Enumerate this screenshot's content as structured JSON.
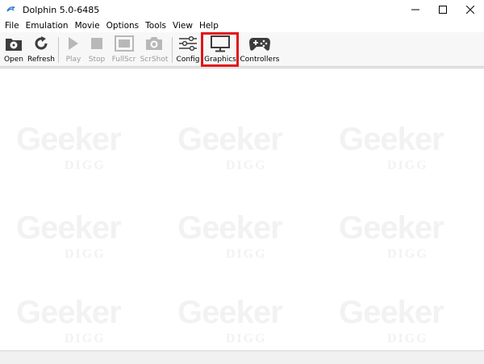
{
  "window": {
    "title": "Dolphin 5.0-6485",
    "icon": "dolphin-icon",
    "controls": [
      "minimize-icon",
      "maximize-icon",
      "close-icon"
    ]
  },
  "menu": [
    "File",
    "Emulation",
    "Movie",
    "Options",
    "Tools",
    "View",
    "Help"
  ],
  "toolbar": {
    "open": {
      "label": "Open",
      "icon": "folder-open-icon",
      "enabled": true
    },
    "refresh": {
      "label": "Refresh",
      "icon": "refresh-icon",
      "enabled": true
    },
    "play": {
      "label": "Play",
      "icon": "play-icon",
      "enabled": false
    },
    "stop": {
      "label": "Stop",
      "icon": "stop-icon",
      "enabled": false
    },
    "fullscr": {
      "label": "FullScr",
      "icon": "fullscreen-icon",
      "enabled": false
    },
    "scrshot": {
      "label": "ScrShot",
      "icon": "camera-icon",
      "enabled": false
    },
    "config": {
      "label": "Config",
      "icon": "sliders-icon",
      "enabled": true
    },
    "graphics": {
      "label": "Graphics",
      "icon": "monitor-icon",
      "enabled": true,
      "highlighted": true
    },
    "controllers": {
      "label": "Controllers",
      "icon": "gamepad-icon",
      "enabled": true
    }
  },
  "highlight_color": "#e3141a",
  "watermark": {
    "text": "Geeker",
    "subtext": "DIGG"
  }
}
